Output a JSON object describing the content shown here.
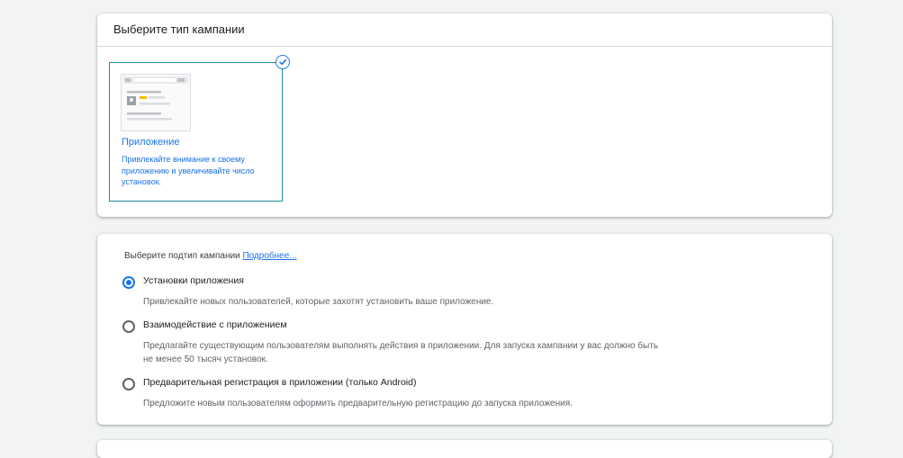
{
  "campaign_type": {
    "header": "Выберите тип кампании",
    "tile": {
      "title": "Приложение",
      "description": "Привлекайте внимание к своему приложению и увеличивайте число установок.",
      "selected": true
    }
  },
  "subtype": {
    "label": "Выберите подтип кампании",
    "link": "Подробнее...",
    "options": [
      {
        "title": "Установки приложения",
        "description": "Привлекайте новых пользователей, которые захотят установить ваше приложение.",
        "checked": true
      },
      {
        "title": "Взаимодействие с приложением",
        "description": "Предлагайте существующим пользователям выполнять действия в приложении. Для запуска кампании у вас должно быть не менее 50 тысяч установок.",
        "checked": false
      },
      {
        "title": "Предварительная регистрация в приложении (только Android)",
        "description": "Предложите новым пользователям оформить предварительную регистрацию до запуска приложения.",
        "checked": false
      }
    ]
  },
  "colors": {
    "accent": "#1a73e8",
    "tile_border": "#1e8e9e",
    "badge_yellow": "#fbbc04"
  }
}
